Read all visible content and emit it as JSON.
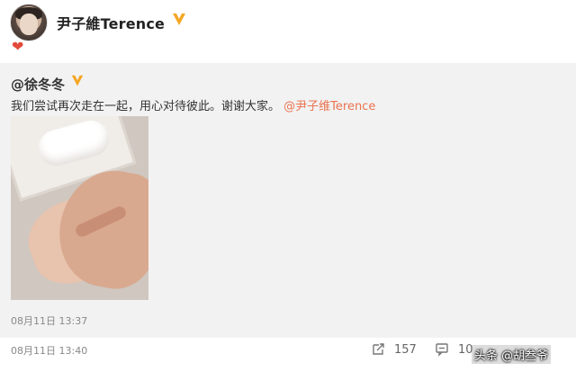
{
  "author": {
    "name": "尹子維Terence",
    "badge_icon": "verified-v-icon",
    "emoji": "❤"
  },
  "repost": {
    "user": "@徐冬冬",
    "badge_icon": "verified-v-icon",
    "text_main": "我们尝试再次走在一起，用心对待彼此。谢谢大家。",
    "mention": "@尹子维Terence",
    "time": "08月11日 13:37"
  },
  "post": {
    "time": "08月11日 13:40",
    "repost_count": "157",
    "comment_count": "10"
  },
  "watermark": "头条 @胡叁爷",
  "colors": {
    "mention": "#eb7350",
    "badge": "#f5a623",
    "repost_bg": "#f2f2f2"
  }
}
